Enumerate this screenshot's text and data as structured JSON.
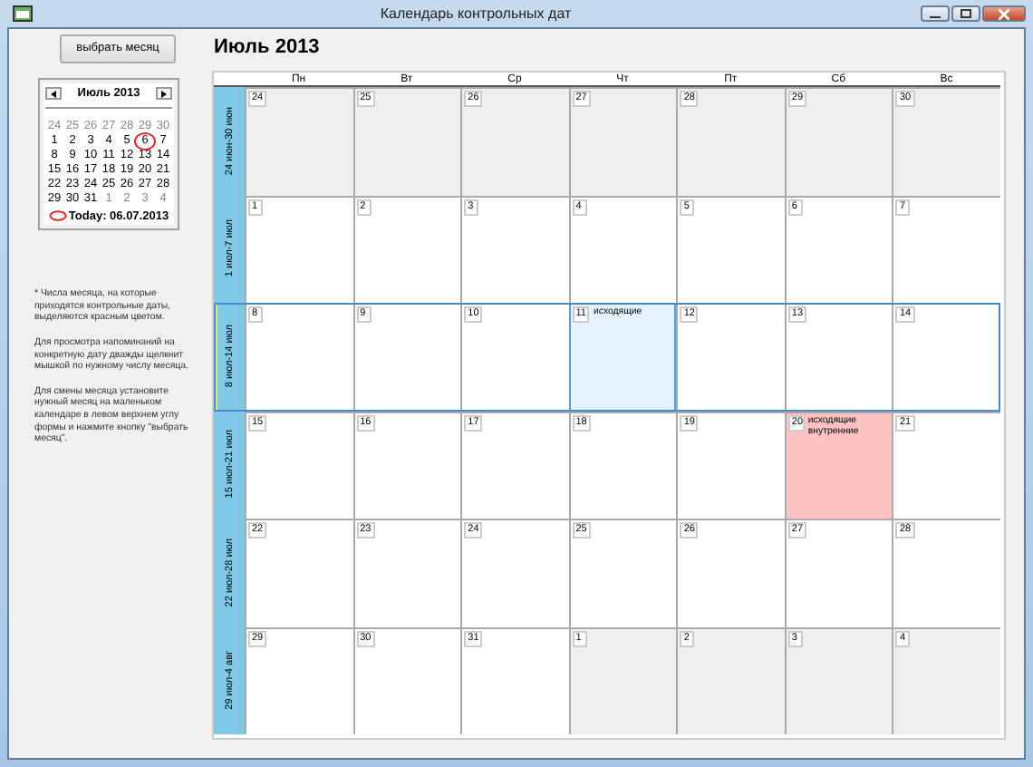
{
  "window": {
    "title": "Календарь контрольных дат"
  },
  "month_button": "выбрать месяц",
  "month_title": "Июль 2013",
  "mini_calendar": {
    "month_label": "Июль 2013",
    "days": [
      {
        "day": "24",
        "other_month": true,
        "today": false
      },
      {
        "day": "25",
        "other_month": true,
        "today": false
      },
      {
        "day": "26",
        "other_month": true,
        "today": false
      },
      {
        "day": "27",
        "other_month": true,
        "today": false
      },
      {
        "day": "28",
        "other_month": true,
        "today": false
      },
      {
        "day": "29",
        "other_month": true,
        "today": false
      },
      {
        "day": "30",
        "other_month": true,
        "today": false
      },
      {
        "day": "1",
        "other_month": false,
        "today": false
      },
      {
        "day": "2",
        "other_month": false,
        "today": false
      },
      {
        "day": "3",
        "other_month": false,
        "today": false
      },
      {
        "day": "4",
        "other_month": false,
        "today": false
      },
      {
        "day": "5",
        "other_month": false,
        "today": false
      },
      {
        "day": "6",
        "other_month": false,
        "today": true
      },
      {
        "day": "7",
        "other_month": false,
        "today": false
      },
      {
        "day": "8",
        "other_month": false,
        "today": false
      },
      {
        "day": "9",
        "other_month": false,
        "today": false
      },
      {
        "day": "10",
        "other_month": false,
        "today": false
      },
      {
        "day": "11",
        "other_month": false,
        "today": false
      },
      {
        "day": "12",
        "other_month": false,
        "today": false
      },
      {
        "day": "13",
        "other_month": false,
        "today": false
      },
      {
        "day": "14",
        "other_month": false,
        "today": false
      },
      {
        "day": "15",
        "other_month": false,
        "today": false
      },
      {
        "day": "16",
        "other_month": false,
        "today": false
      },
      {
        "day": "17",
        "other_month": false,
        "today": false
      },
      {
        "day": "18",
        "other_month": false,
        "today": false
      },
      {
        "day": "19",
        "other_month": false,
        "today": false
      },
      {
        "day": "20",
        "other_month": false,
        "today": false
      },
      {
        "day": "21",
        "other_month": false,
        "today": false
      },
      {
        "day": "22",
        "other_month": false,
        "today": false
      },
      {
        "day": "23",
        "other_month": false,
        "today": false
      },
      {
        "day": "24",
        "other_month": false,
        "today": false
      },
      {
        "day": "25",
        "other_month": false,
        "today": false
      },
      {
        "day": "26",
        "other_month": false,
        "today": false
      },
      {
        "day": "27",
        "other_month": false,
        "today": false
      },
      {
        "day": "28",
        "other_month": false,
        "today": false
      },
      {
        "day": "29",
        "other_month": false,
        "today": false
      },
      {
        "day": "30",
        "other_month": false,
        "today": false
      },
      {
        "day": "31",
        "other_month": false,
        "today": false
      },
      {
        "day": "1",
        "other_month": true,
        "today": false
      },
      {
        "day": "2",
        "other_month": true,
        "today": false
      },
      {
        "day": "3",
        "other_month": true,
        "today": false
      },
      {
        "day": "4",
        "other_month": true,
        "today": false
      }
    ],
    "today_label": "Today: 06.07.2013"
  },
  "notes": [
    "* Числа месяца, на которые приходятся контрольные даты, выделяются красным цветом.",
    "Для просмотра напоминаний на конкретную дату дважды щелкнит мышкой по нужному числу месяца.",
    "Для смены месяца установите нужный месяц на маленьком календаре в левом верхнем углу формы и нажмите кнопку \"выбрать месяц\"."
  ],
  "calendar": {
    "weekdays": [
      "Пн",
      "Вт",
      "Ср",
      "Чт",
      "Пт",
      "Сб",
      "Вс"
    ],
    "weeks": [
      {
        "label": "24 июн-30 июн",
        "selected": false,
        "days": [
          {
            "day": "24",
            "other_month": true
          },
          {
            "day": "25",
            "other_month": true
          },
          {
            "day": "26",
            "other_month": true
          },
          {
            "day": "27",
            "other_month": true
          },
          {
            "day": "28",
            "other_month": true
          },
          {
            "day": "29",
            "other_month": true
          },
          {
            "day": "30",
            "other_month": true
          }
        ]
      },
      {
        "label": "1 июл-7 июл",
        "selected": false,
        "days": [
          {
            "day": "1",
            "other_month": false
          },
          {
            "day": "2",
            "other_month": false
          },
          {
            "day": "3",
            "other_month": false
          },
          {
            "day": "4",
            "other_month": false
          },
          {
            "day": "5",
            "other_month": false
          },
          {
            "day": "6",
            "other_month": false
          },
          {
            "day": "7",
            "other_month": false
          }
        ]
      },
      {
        "label": "8 июл-14 июл",
        "selected": true,
        "days": [
          {
            "day": "8",
            "other_month": false
          },
          {
            "day": "9",
            "other_month": false
          },
          {
            "day": "10",
            "other_month": false
          },
          {
            "day": "11",
            "other_month": false,
            "selected": true,
            "event": "исходящие"
          },
          {
            "day": "12",
            "other_month": false
          },
          {
            "day": "13",
            "other_month": false
          },
          {
            "day": "14",
            "other_month": false
          }
        ]
      },
      {
        "label": "15 июл-21 июл",
        "selected": false,
        "days": [
          {
            "day": "15",
            "other_month": false
          },
          {
            "day": "16",
            "other_month": false
          },
          {
            "day": "17",
            "other_month": false
          },
          {
            "day": "18",
            "other_month": false
          },
          {
            "day": "19",
            "other_month": false
          },
          {
            "day": "20",
            "other_month": false,
            "marked": true,
            "event": "исходящие внутренние"
          },
          {
            "day": "21",
            "other_month": false
          }
        ]
      },
      {
        "label": "22 июл-28 июл",
        "selected": false,
        "days": [
          {
            "day": "22",
            "other_month": false
          },
          {
            "day": "23",
            "other_month": false
          },
          {
            "day": "24",
            "other_month": false
          },
          {
            "day": "25",
            "other_month": false
          },
          {
            "day": "26",
            "other_month": false
          },
          {
            "day": "27",
            "other_month": false
          },
          {
            "day": "28",
            "other_month": false
          }
        ]
      },
      {
        "label": "29 июл-4 авг",
        "selected": false,
        "days": [
          {
            "day": "29",
            "other_month": false
          },
          {
            "day": "30",
            "other_month": false
          },
          {
            "day": "31",
            "other_month": false
          },
          {
            "day": "1",
            "other_month": true
          },
          {
            "day": "2",
            "other_month": true
          },
          {
            "day": "3",
            "other_month": true
          },
          {
            "day": "4",
            "other_month": true
          }
        ]
      }
    ]
  }
}
